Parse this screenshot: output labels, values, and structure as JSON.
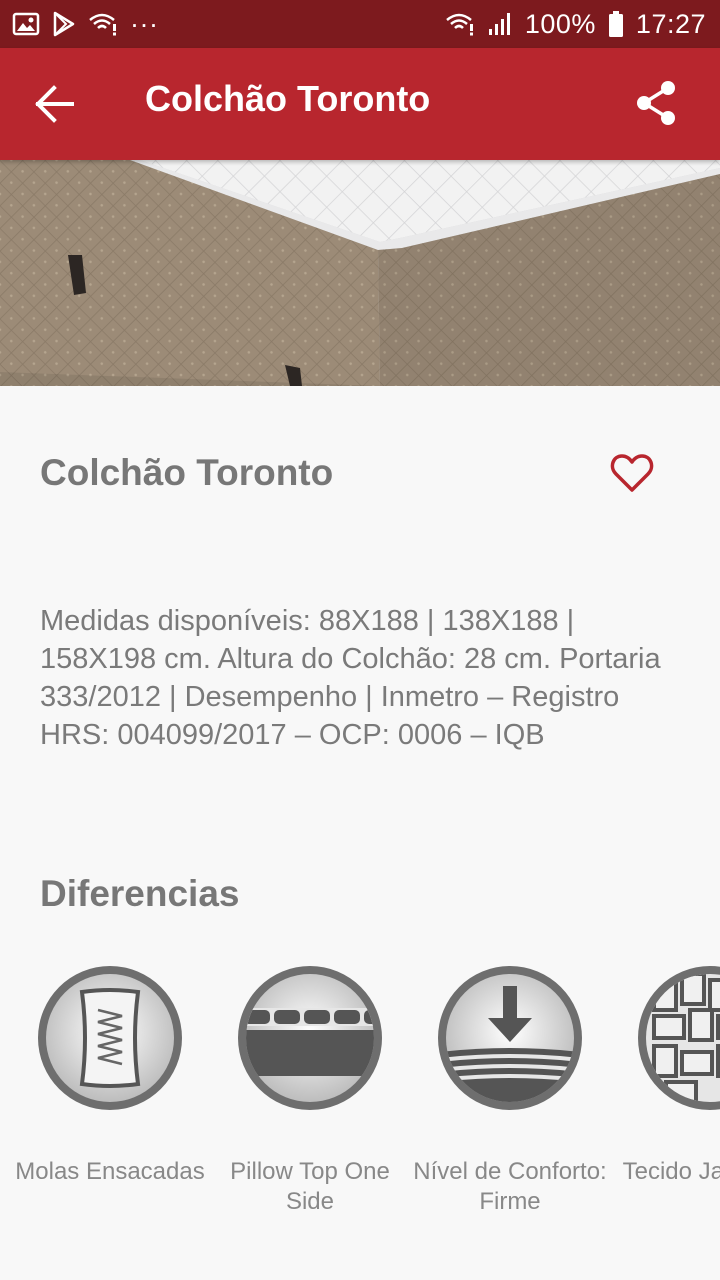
{
  "status_bar": {
    "battery": "100%",
    "time": "17:27",
    "more": "···",
    "icons": [
      "image-icon",
      "play-store-icon",
      "wifi-question-icon",
      "more-icon",
      "wifi-icon",
      "signal-icon",
      "battery-icon"
    ]
  },
  "app_bar": {
    "title": "Colchão Toronto",
    "back_icon": "arrow-back-icon",
    "share_icon": "share-icon"
  },
  "carousel": {
    "pages": 2,
    "active_page": 1
  },
  "product": {
    "title": "Colchão Toronto",
    "favorite_icon": "heart-outline-icon",
    "description": "Medidas disponíveis: 88X188 | 138X188 | 158X198 cm. Altura do Colchão: 28 cm. Portaria 333/2012 | Desempenho | Inmetro – Registro HRS: 004099/2017 – OCP: 0006 – IQB"
  },
  "diferencias": {
    "title": "Diferencias",
    "items": [
      {
        "label": "Molas Ensacadas",
        "icon": "pocket-springs-icon"
      },
      {
        "label": "Pillow Top One Side",
        "icon": "pillow-top-icon"
      },
      {
        "label": "Nível de Conforto: Firme",
        "icon": "comfort-level-icon"
      },
      {
        "label": "Tecido Jacquard",
        "icon": "fabric-weave-icon"
      }
    ]
  },
  "colors": {
    "status_bar": "#7d1a1e",
    "app_bar": "#b8262e",
    "accent": "#b8262e",
    "text_gray": "#777777"
  }
}
